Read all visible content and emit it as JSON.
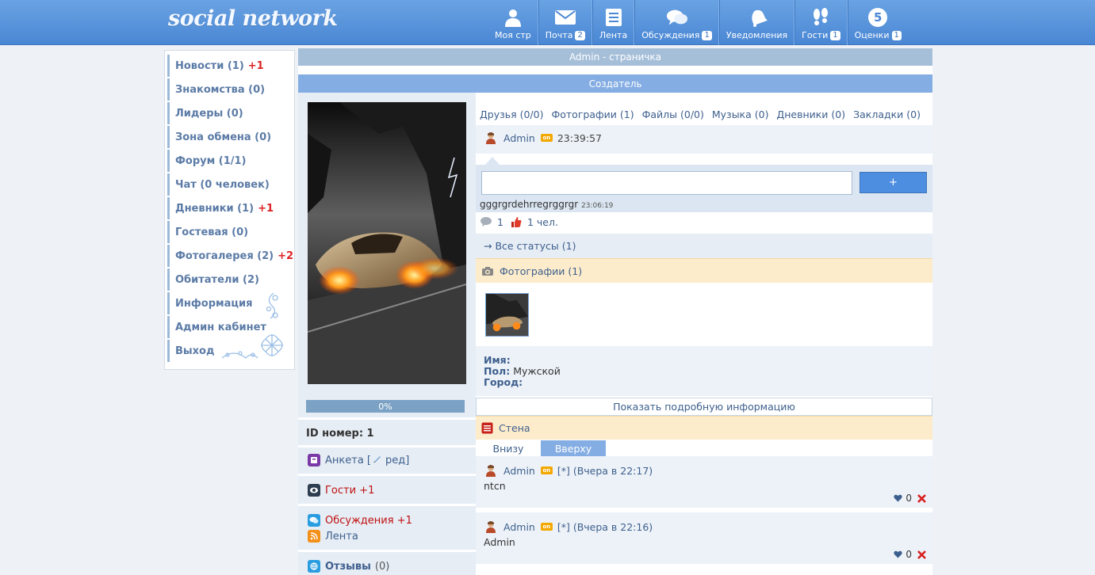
{
  "header": {
    "logo": "social network",
    "nav": [
      {
        "label": "Моя стр",
        "badge": "",
        "icon": "user-icon"
      },
      {
        "label": "Почта",
        "badge": "2",
        "icon": "mail-icon"
      },
      {
        "label": "Лента",
        "badge": "",
        "icon": "feed-icon"
      },
      {
        "label": "Обсуждения",
        "badge": "1",
        "icon": "chat-icon"
      },
      {
        "label": "Уведомления",
        "badge": "",
        "icon": "bell-icon"
      },
      {
        "label": "Гости",
        "badge": "1",
        "icon": "footprints-icon"
      },
      {
        "label": "Оценки",
        "badge": "1",
        "icon": "rating-icon",
        "icon_text": "5"
      }
    ]
  },
  "left_menu": [
    {
      "label": "Новости (1)",
      "plus": "+1"
    },
    {
      "label": "Знакомства (0)",
      "plus": ""
    },
    {
      "label": "Лидеры (0)",
      "plus": ""
    },
    {
      "label": "Зона обмена (0)",
      "plus": ""
    },
    {
      "label": "Форум (1/1)",
      "plus": ""
    },
    {
      "label": "Чат (0 человек)",
      "plus": ""
    },
    {
      "label": "Дневники (1)",
      "plus": "+1"
    },
    {
      "label": "Гостевая (0)",
      "plus": ""
    },
    {
      "label": "Фотогалерея (2)",
      "plus": "+2"
    },
    {
      "label": "Обитатели (2)",
      "plus": ""
    },
    {
      "label": "Информация",
      "plus": ""
    },
    {
      "label": "Админ кабинет",
      "plus": ""
    },
    {
      "label": "Выход",
      "plus": ""
    }
  ],
  "profile": {
    "title": "Admin - страничка",
    "role": "Создатель",
    "progress": "0%",
    "progress_value": 0,
    "id_label": "ID номер: 1",
    "links": {
      "anketa": "Анкета [",
      "anketa_edit": "ред]",
      "guests": "Гости +1",
      "discussions": "Обсуждения +1",
      "feed": "Лента",
      "reviews": "Отзывы",
      "reviews_count": "(0)"
    }
  },
  "tabs": [
    "Друзья (0/0)",
    "Фотографии (1)",
    "Файлы (0/0)",
    "Музыка (0)",
    "Дневники (0)",
    "Закладки (0)"
  ],
  "status": {
    "user": "Admin",
    "online": "on",
    "time": "23:39:57",
    "input_value": "",
    "button": "+",
    "text": "gggrgrdehrregrggrgr",
    "text_time": "23:06:19",
    "comments": "1",
    "likes": "1 чел.",
    "all_statuses": "→ Все статусы (1)"
  },
  "photos": {
    "header": "Фотографии (1)"
  },
  "info": {
    "name_label": "Имя:",
    "name_value": "",
    "sex_label": "Пол:",
    "sex_value": "Мужской",
    "city_label": "Город:",
    "city_value": "",
    "show_more": "Показать подробную информацию"
  },
  "wall": {
    "header": "Стена",
    "tab_bottom": "Внизу",
    "tab_top": "Вверху",
    "posts": [
      {
        "user": "Admin",
        "online": "on",
        "meta": "[*] (Вчера в 22:17)",
        "text": "ntcn",
        "likes": "0"
      },
      {
        "user": "Admin",
        "online": "on",
        "meta": "[*] (Вчера в 22:16)",
        "text": "Admin",
        "likes": "0"
      }
    ]
  },
  "colors": {
    "topbar": "#4a87d4",
    "accent": "#84ade3",
    "highlight": "#fdeccb",
    "red": "#c01010"
  }
}
